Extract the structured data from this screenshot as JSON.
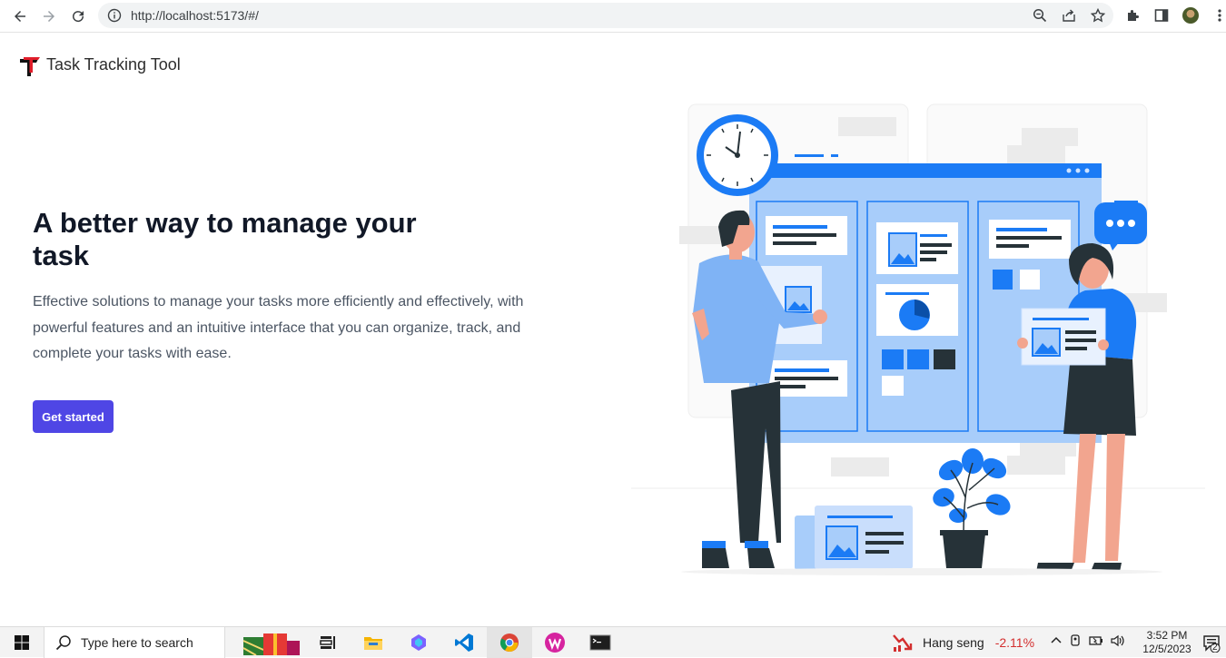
{
  "browser": {
    "url": "http://localhost:5173/#/",
    "icons": [
      "back-icon",
      "forward-icon",
      "reload-icon",
      "site-info-icon",
      "zoom-icon",
      "share-icon",
      "bookmark-star-icon",
      "extensions-icon",
      "side-panel-icon",
      "profile-avatar",
      "menu-icon"
    ]
  },
  "app": {
    "brand": "Task Tracking Tool",
    "brand_color": "#e11d2a"
  },
  "hero": {
    "title": "A better way to manage your task",
    "description": "Effective solutions to manage your tasks more efficiently and effectively, with powerful features and an intuitive interface that you can organize, track, and complete your tasks with ease.",
    "cta_label": "Get started",
    "accent": "#4f46e5"
  },
  "illustration": {
    "accent": "#1b7bf5"
  },
  "taskbar": {
    "search_placeholder": "Type here to search",
    "stock_name": "Hang seng",
    "stock_change": "-2.11%",
    "time": "3:52 PM",
    "date": "12/5/2023",
    "notification_count": "2",
    "apps": [
      "gift-app-icon",
      "task-view-icon",
      "file-explorer-icon",
      "copilot-icon",
      "vscode-icon",
      "chrome-icon",
      "wps-icon",
      "terminal-icon"
    ]
  }
}
